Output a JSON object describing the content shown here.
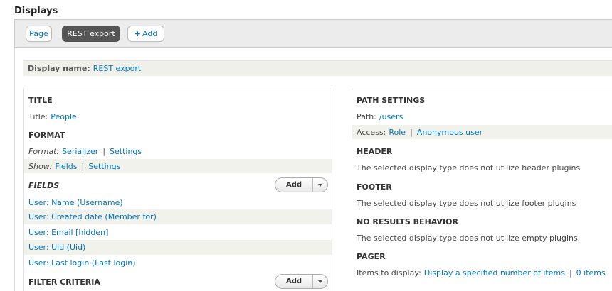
{
  "page": {
    "heading": "Displays"
  },
  "tabs": {
    "page": "Page",
    "rest_export": "REST export",
    "add_plus": "+",
    "add": "Add"
  },
  "display_name": {
    "label": "Display name:",
    "value": "REST export"
  },
  "left": {
    "title": {
      "heading": "TITLE",
      "label": "Title:",
      "value": "People"
    },
    "format": {
      "heading": "FORMAT",
      "format_label": "Format:",
      "format_value": "Serializer",
      "format_settings": "Settings",
      "show_label": "Show:",
      "show_value": "Fields",
      "show_settings": "Settings"
    },
    "fields": {
      "heading": "FIELDS",
      "add_button": "Add",
      "items": [
        "User: Name (Username)",
        "User: Created date (Member for)",
        "User: Email [hidden]",
        "User: Uid (Uid)",
        "User: Last login (Last login)"
      ]
    },
    "filter": {
      "heading": "FILTER CRITERIA",
      "add_button": "Add"
    }
  },
  "right": {
    "path": {
      "heading": "PATH SETTINGS",
      "path_label": "Path:",
      "path_value": "/users",
      "access_label": "Access:",
      "access_role": "Role",
      "access_value": "Anonymous user"
    },
    "header": {
      "heading": "HEADER",
      "text": "The selected display type does not utilize header plugins"
    },
    "footer": {
      "heading": "FOOTER",
      "text": "The selected display type does not utilize footer plugins"
    },
    "no_results": {
      "heading": "NO RESULTS BEHAVIOR",
      "text": "The selected display type does not utilize empty plugins"
    },
    "pager": {
      "heading": "PAGER",
      "label": "Items to display:",
      "value": "Display a specified number of items",
      "items": "0 items"
    }
  },
  "separator": "|"
}
